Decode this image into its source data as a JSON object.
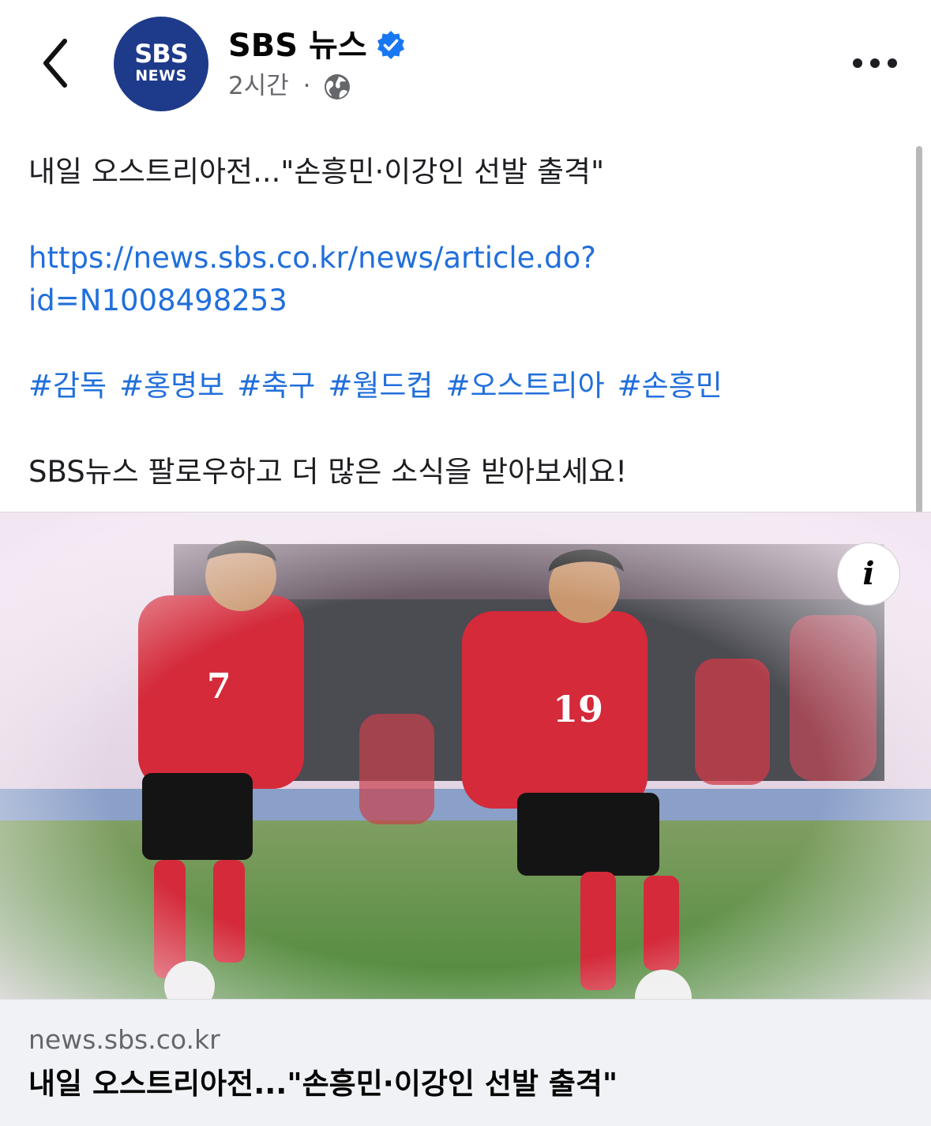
{
  "header": {
    "avatar_line1": "SBS",
    "avatar_line2": "NEWS",
    "page_name": "SBS 뉴스",
    "timestamp": "2시간",
    "separator": "·",
    "privacy_icon": "globe-icon",
    "verified_icon": "verified-badge-icon",
    "more_icon": "more-options-icon",
    "back_icon": "back-chevron-icon"
  },
  "post": {
    "headline": "내일 오스트리아전...\"손흥민·이강인 선발 출격\"",
    "link_line1": "https://news.sbs.co.kr/news/article.do?",
    "link_line2": "id=N1008498253",
    "hashtags": [
      "#감독",
      "#홍명보",
      "#축구",
      "#월드컵",
      "#오스트리아",
      "#손흥민"
    ],
    "cta": "SBS뉴스 팔로우하고 더 많은 소식을 받아보세요!"
  },
  "media": {
    "description": "photo-of-two-korean-football-players-in-red-kits",
    "player_numbers": [
      "7",
      "19"
    ],
    "info_label": "i"
  },
  "link_preview": {
    "domain": "news.sbs.co.kr",
    "title": "내일 오스트리아전...\"손흥민·이강인 선발 출격\""
  },
  "colors": {
    "link_blue": "#216fdb",
    "verified_blue": "#1877f2",
    "sbs_navy": "#1e3a8a",
    "kit_red": "#d42a3a"
  }
}
